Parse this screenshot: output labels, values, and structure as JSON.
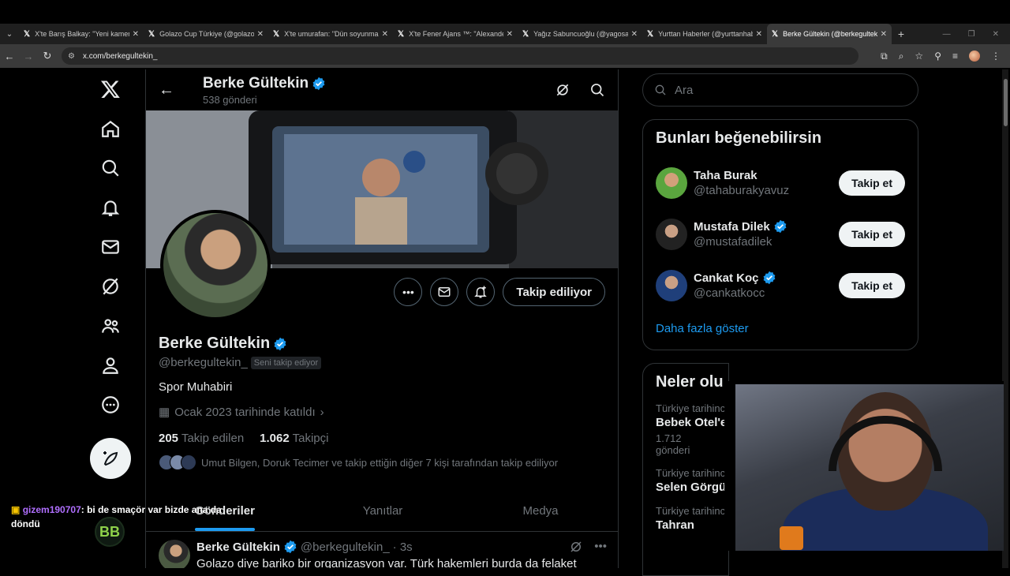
{
  "browser": {
    "tabs": [
      {
        "title": "X'te Barış Balkay: \"Yeni kamera",
        "active": false
      },
      {
        "title": "Golazo Cup Türkiye (@golazoc",
        "active": false
      },
      {
        "title": "X'te umurafan: \"Dün soyunma",
        "active": false
      },
      {
        "title": "X'te Fener Ajans ™: \"Alexander",
        "active": false
      },
      {
        "title": "Yağız Sabuncuoğlu (@yagosab",
        "active": false
      },
      {
        "title": "Yurttan Haberler (@yurttanhab",
        "active": false
      },
      {
        "title": "Berke Gültekin (@berkegultekin",
        "active": true
      }
    ],
    "url": "x.com/berkegultekin_"
  },
  "profile": {
    "header_name": "Berke Gültekin",
    "post_count": "538 gönderi",
    "name": "Berke Gültekin",
    "handle": "@berkegultekin_",
    "follows_you": "Seni takip ediyor",
    "bio": "Spor Muhabiri",
    "joined": "Ocak 2023 tarihinde katıldı",
    "following_count": "205",
    "following_label": "Takip edilen",
    "followers_count": "1.062",
    "followers_label": "Takipçi",
    "followed_by": "Umut Bilgen, Doruk Tecimer ve takip ettiğin diğer 7 kişi tarafından takip ediliyor",
    "follow_state": "Takip ediliyor",
    "tabs": [
      "Gönderiler",
      "Yanıtlar",
      "Medya"
    ]
  },
  "tweet": {
    "name": "Berke Gültekin",
    "handle": "@berkegultekin_",
    "time": "· 3s",
    "text": "Golazo diye bariko bir organizasyon var. Türk hakemleri burda da felaket"
  },
  "sidebar": {
    "search_placeholder": "Ara",
    "who_to_follow_title": "Bunları beğenebilirsin",
    "suggestions": [
      {
        "name": "Taha Burak",
        "handle": "@tahaburakyavuz",
        "verified": false,
        "button": "Takip et"
      },
      {
        "name": "Mustafa Dilek",
        "handle": "@mustafadilek",
        "verified": true,
        "button": "Takip et"
      },
      {
        "name": "Cankat Koç",
        "handle": "@cankatkocc",
        "verified": true,
        "button": "Takip et"
      }
    ],
    "show_more": "Daha fazla göster",
    "trends_title": "Neler olu",
    "trends": [
      {
        "context": "Türkiye tarihinc",
        "name": "Bebek Otel'e",
        "count": "1.712 gönderi"
      },
      {
        "context": "Türkiye tarihinc",
        "name": "Selen Görgü",
        "count": ""
      },
      {
        "context": "Türkiye tarihinc",
        "name": "Tahran",
        "count": ""
      }
    ]
  },
  "chat": {
    "user": "gizem190707",
    "message": ": bi de smaçör var bizde ana da döndü",
    "logo": "BB"
  },
  "colors": {
    "accent": "#1d9bf0",
    "background": "#000000",
    "border": "#2f3336",
    "muted": "#71767b"
  }
}
